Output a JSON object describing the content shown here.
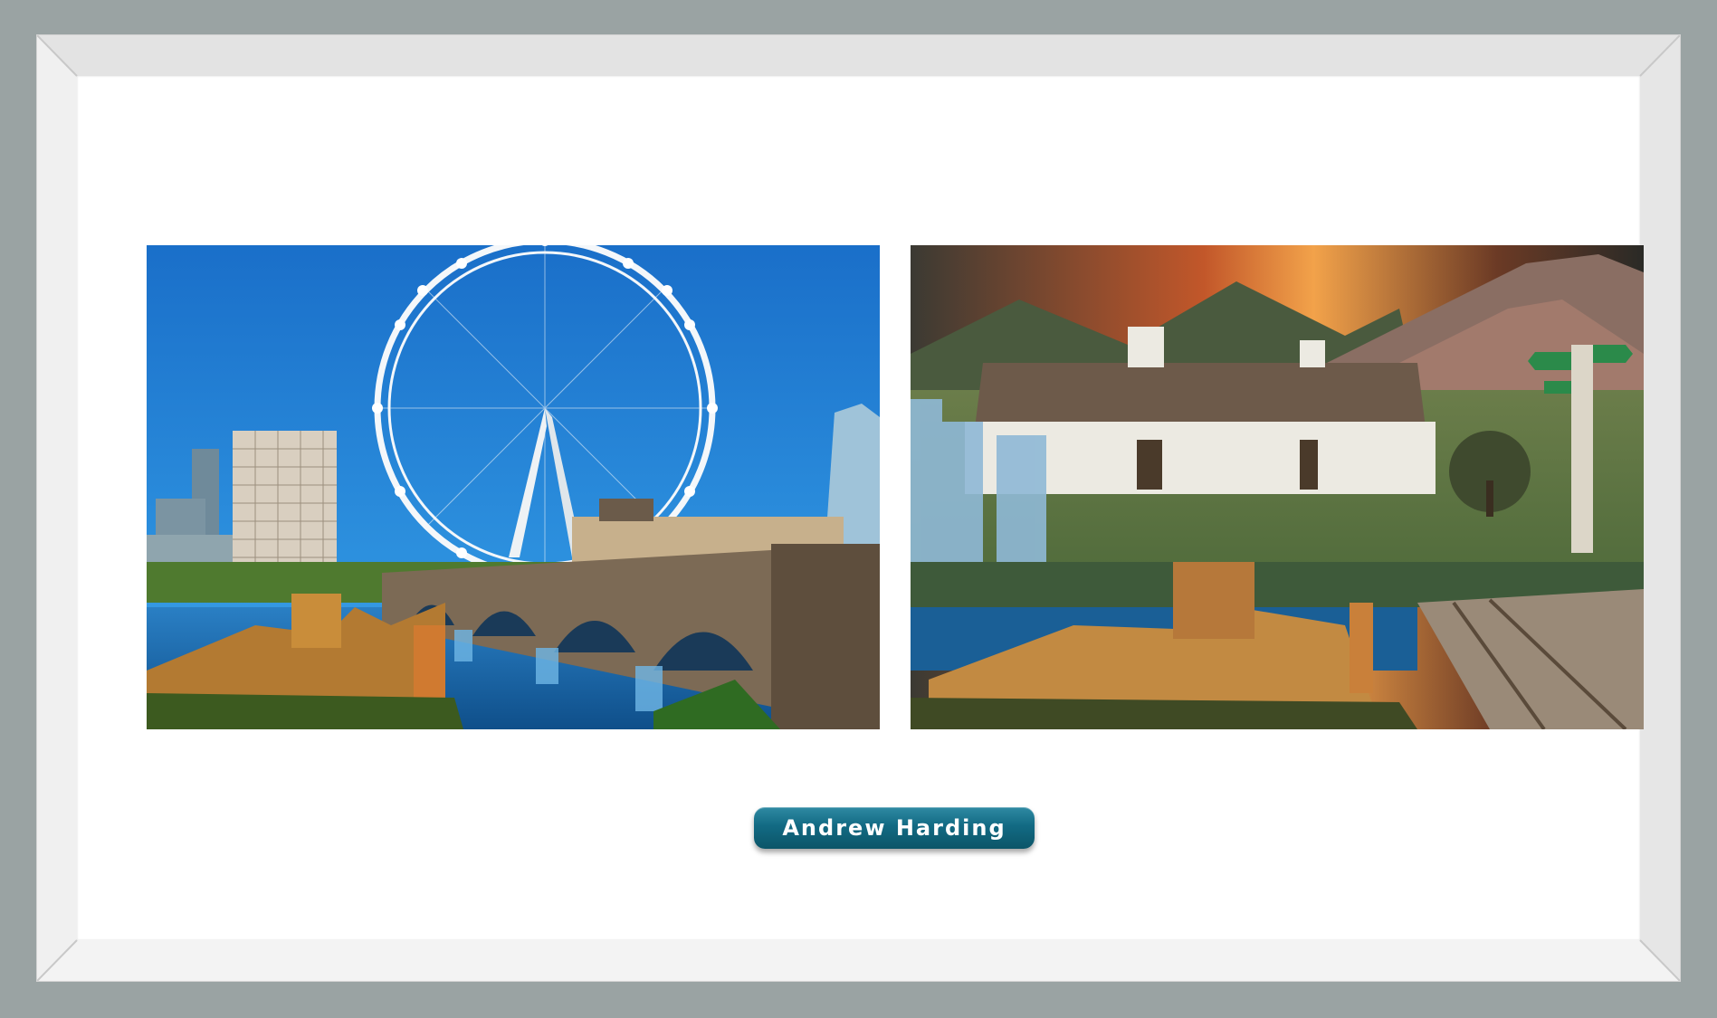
{
  "artist": {
    "name": "Andrew Harding"
  },
  "artworks": [
    {
      "icon": "london-eye-collage-image"
    },
    {
      "icon": "cottage-landscape-collage-image"
    }
  ],
  "colors": {
    "wall": "#9aa3a3",
    "frame": "#eeeeee",
    "mat": "#ffffff",
    "plate": "#126a83",
    "plate_text": "#ffffff"
  }
}
